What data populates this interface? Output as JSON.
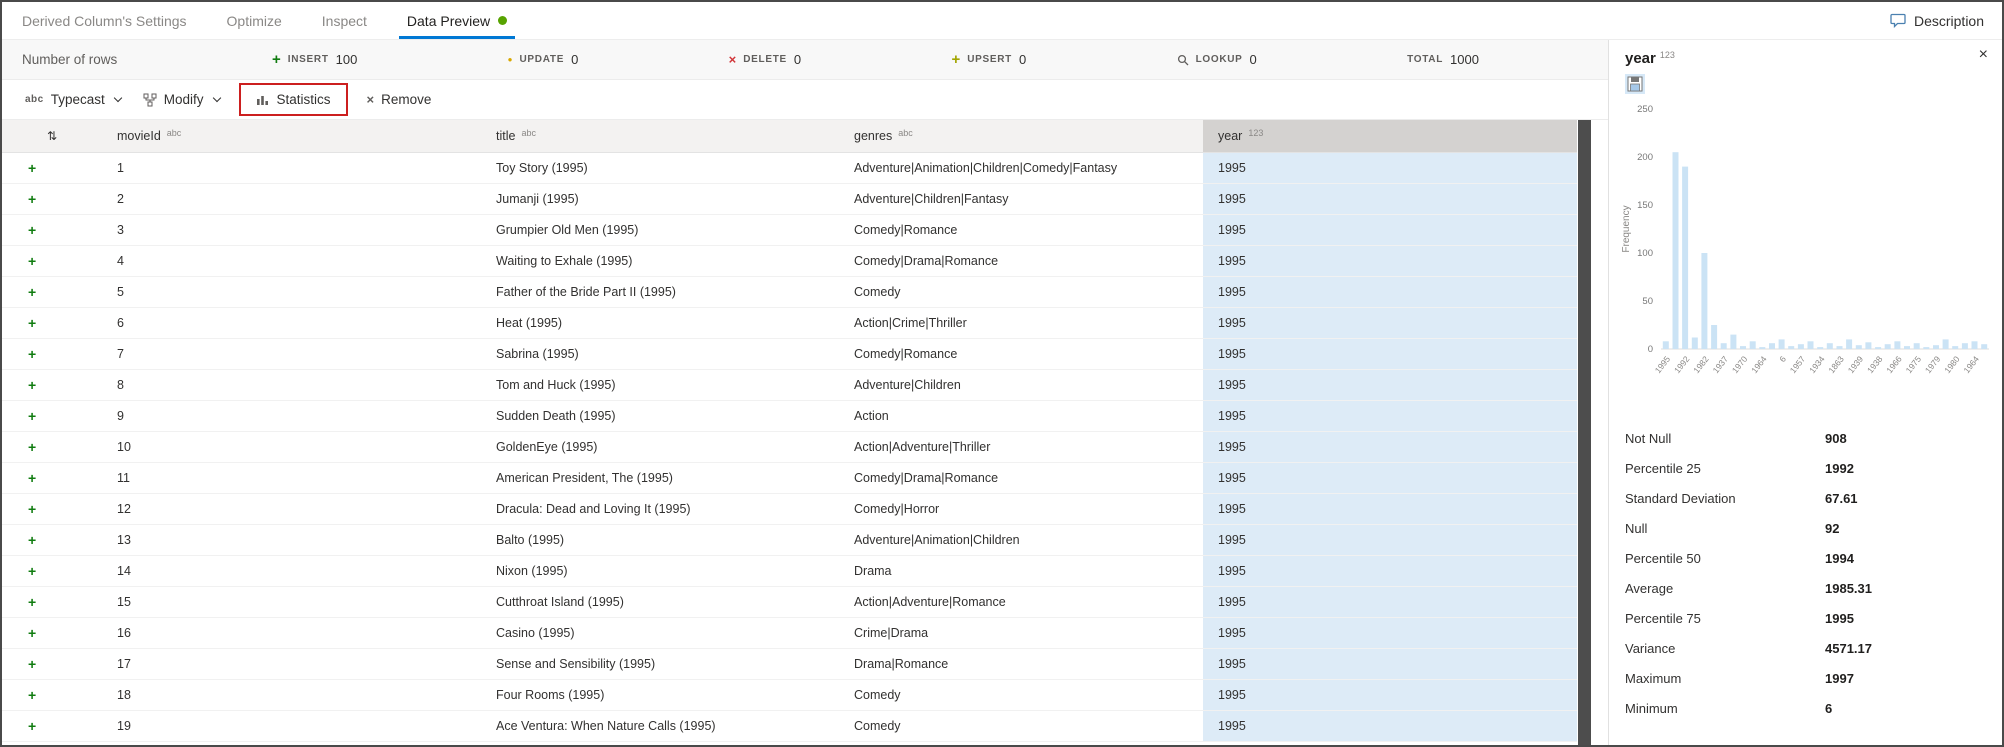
{
  "tabs": {
    "items": [
      {
        "label": "Derived Column's Settings",
        "active": false,
        "has_green_dot": false
      },
      {
        "label": "Optimize",
        "active": false,
        "has_green_dot": false
      },
      {
        "label": "Inspect",
        "active": false,
        "has_green_dot": false
      },
      {
        "label": "Data Preview",
        "active": true,
        "has_green_dot": true
      }
    ],
    "description_label": "Description"
  },
  "counts_bar": {
    "label": "Number of rows",
    "badges": [
      {
        "id": "insert",
        "label": "INSERT",
        "value": "100"
      },
      {
        "id": "update",
        "label": "UPDATE",
        "value": "0"
      },
      {
        "id": "delete",
        "label": "DELETE",
        "value": "0"
      },
      {
        "id": "upsert",
        "label": "UPSERT",
        "value": "0"
      },
      {
        "id": "lookup",
        "label": "LOOKUP",
        "value": "0"
      },
      {
        "id": "total",
        "label": "TOTAL",
        "value": "1000"
      }
    ]
  },
  "toolbar": {
    "abc_icon": "abc",
    "typecast_label": "Typecast",
    "modify_label": "Modify",
    "statistics_label": "Statistics",
    "remove_label": "Remove"
  },
  "table": {
    "columns": [
      {
        "key": "movieId",
        "label": "movieId",
        "type": "abc",
        "selected": false
      },
      {
        "key": "title",
        "label": "title",
        "type": "abc",
        "selected": false
      },
      {
        "key": "genres",
        "label": "genres",
        "type": "abc",
        "selected": false
      },
      {
        "key": "year",
        "label": "year",
        "type": "123",
        "selected": true
      }
    ],
    "rows": [
      [
        "1",
        "Toy Story (1995)",
        "Adventure|Animation|Children|Comedy|Fantasy",
        "1995"
      ],
      [
        "2",
        "Jumanji (1995)",
        "Adventure|Children|Fantasy",
        "1995"
      ],
      [
        "3",
        "Grumpier Old Men (1995)",
        "Comedy|Romance",
        "1995"
      ],
      [
        "4",
        "Waiting to Exhale (1995)",
        "Comedy|Drama|Romance",
        "1995"
      ],
      [
        "5",
        "Father of the Bride Part II (1995)",
        "Comedy",
        "1995"
      ],
      [
        "6",
        "Heat (1995)",
        "Action|Crime|Thriller",
        "1995"
      ],
      [
        "7",
        "Sabrina (1995)",
        "Comedy|Romance",
        "1995"
      ],
      [
        "8",
        "Tom and Huck (1995)",
        "Adventure|Children",
        "1995"
      ],
      [
        "9",
        "Sudden Death (1995)",
        "Action",
        "1995"
      ],
      [
        "10",
        "GoldenEye (1995)",
        "Action|Adventure|Thriller",
        "1995"
      ],
      [
        "11",
        "American President, The (1995)",
        "Comedy|Drama|Romance",
        "1995"
      ],
      [
        "12",
        "Dracula: Dead and Loving It (1995)",
        "Comedy|Horror",
        "1995"
      ],
      [
        "13",
        "Balto (1995)",
        "Adventure|Animation|Children",
        "1995"
      ],
      [
        "14",
        "Nixon (1995)",
        "Drama",
        "1995"
      ],
      [
        "15",
        "Cutthroat Island (1995)",
        "Action|Adventure|Romance",
        "1995"
      ],
      [
        "16",
        "Casino (1995)",
        "Crime|Drama",
        "1995"
      ],
      [
        "17",
        "Sense and Sensibility (1995)",
        "Drama|Romance",
        "1995"
      ],
      [
        "18",
        "Four Rooms (1995)",
        "Comedy",
        "1995"
      ],
      [
        "19",
        "Ace Ventura: When Nature Calls (1995)",
        "Comedy",
        "1995"
      ]
    ]
  },
  "panel": {
    "title": "year",
    "type_label": "123",
    "stats": [
      {
        "label": "Not Null",
        "value": "908"
      },
      {
        "label": "Percentile 25",
        "value": "1992"
      },
      {
        "label": "Standard Deviation",
        "value": "67.61"
      },
      {
        "label": "Null",
        "value": "92"
      },
      {
        "label": "Percentile 50",
        "value": "1994"
      },
      {
        "label": "Average",
        "value": "1985.31"
      },
      {
        "label": "Percentile 75",
        "value": "1995"
      },
      {
        "label": "Variance",
        "value": "4571.17"
      },
      {
        "label": "Maximum",
        "value": "1997"
      },
      {
        "label": "Minimum",
        "value": "6"
      }
    ]
  },
  "chart_data": {
    "type": "bar",
    "title": "year",
    "ylabel": "Frequency",
    "ylim": [
      0,
      250
    ],
    "yticks": [
      0,
      50,
      100,
      150,
      200,
      250
    ],
    "bar_color": "#cbe3f5",
    "values": [
      8,
      205,
      190,
      12,
      100,
      25,
      6,
      15,
      3,
      8,
      2,
      6,
      10,
      3,
      5,
      8,
      2,
      6,
      3,
      10,
      4,
      7,
      2,
      5,
      8,
      3,
      6,
      2,
      4,
      10,
      3,
      6,
      8,
      5
    ],
    "xtick_labels": [
      "1995",
      "1992",
      "1982",
      "1937",
      "1970",
      "1964",
      "6",
      "1957",
      "1934",
      "1863",
      "1939",
      "1938",
      "1966",
      "1975",
      "1979",
      "1980",
      "1964"
    ]
  }
}
